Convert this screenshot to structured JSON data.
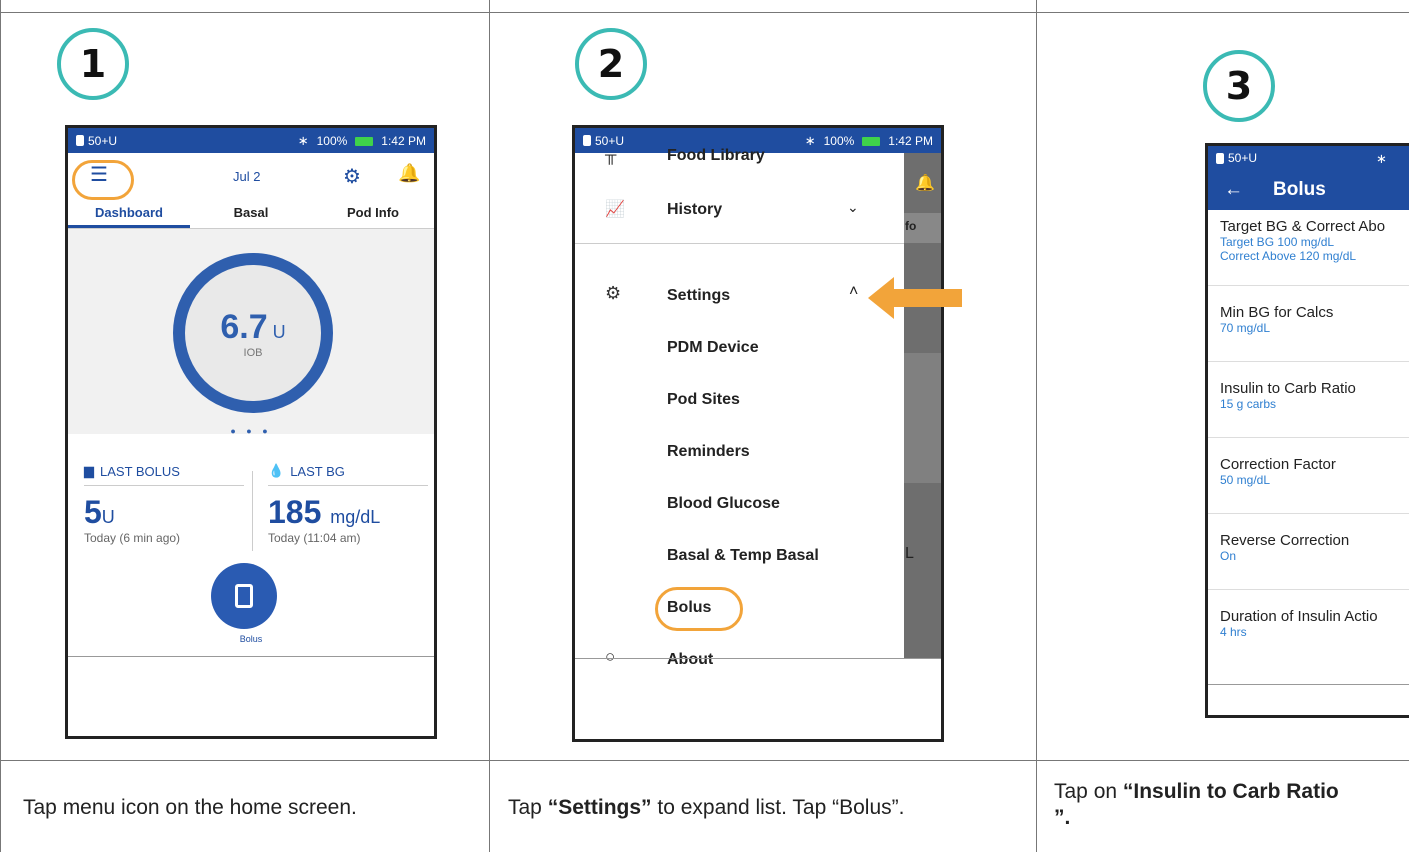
{
  "steps": [
    {
      "number": "1",
      "caption_prefix": "Tap menu icon on the home screen.",
      "caption_bold": "",
      "caption_suffix": ""
    },
    {
      "number": "2",
      "caption_prefix": "Tap ",
      "caption_bold": "“Settings”",
      "caption_suffix": " to expand list. Tap “Bolus”."
    },
    {
      "number": "3",
      "caption_prefix": "Tap on ",
      "caption_bold": "“Insulin to Carb Ratio",
      "caption_suffix": "”."
    }
  ],
  "status_bar": {
    "left": "50+U",
    "battery": "100%",
    "time": "1:42 PM"
  },
  "phone1": {
    "date": "Jul 2",
    "tabs": [
      "Dashboard",
      "Basal",
      "Pod Info"
    ],
    "iob_value": "6.7",
    "iob_unit": "U",
    "iob_label": "IOB",
    "last_bolus_label": "LAST BOLUS",
    "last_bolus_value": "5",
    "last_bolus_unit": "U",
    "last_bolus_time": "Today (6 min ago)",
    "last_bg_label": "LAST BG",
    "last_bg_value": "185",
    "last_bg_unit": "mg/dL",
    "last_bg_time": "Today (11:04 am)",
    "bolus_button_label": "Bolus"
  },
  "phone2": {
    "menu": {
      "food_library": "Food Library",
      "history": "History",
      "settings": "Settings",
      "pdm_device": "PDM Device",
      "pod_sites": "Pod Sites",
      "reminders": "Reminders",
      "blood_glucose": "Blood Glucose",
      "basal_temp": "Basal & Temp Basal",
      "bolus": "Bolus",
      "about": "About"
    },
    "behind_text_1": "fo",
    "behind_text_2": "L"
  },
  "phone3": {
    "title": "Bolus",
    "rows": [
      {
        "title": "Target BG & Correct Abo",
        "sub1": "Target BG 100 mg/dL",
        "sub2": "Correct Above 120 mg/dL"
      },
      {
        "title": "Min BG for Calcs",
        "sub1": "70 mg/dL",
        "sub2": ""
      },
      {
        "title": "Insulin to Carb Ratio",
        "sub1": "15 g carbs",
        "sub2": ""
      },
      {
        "title": "Correction Factor",
        "sub1": "50 mg/dL",
        "sub2": ""
      },
      {
        "title": "Reverse Correction",
        "sub1": "On",
        "sub2": ""
      },
      {
        "title": "Duration of Insulin Actio",
        "sub1": "4 hrs",
        "sub2": ""
      }
    ]
  },
  "colors": {
    "accent": "#1f4da0",
    "highlight": "#f2a43a",
    "step_ring": "#3bbab4"
  }
}
